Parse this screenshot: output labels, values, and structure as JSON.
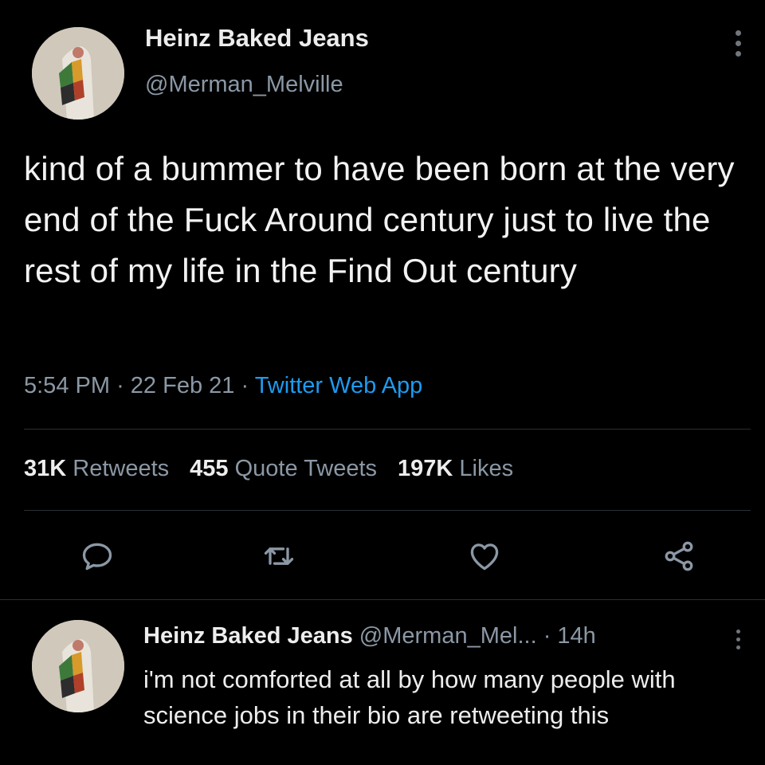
{
  "tweet": {
    "author_name": "Heinz Baked Jeans",
    "author_handle": "@Merman_Melville",
    "text": "kind of a bummer to have been born at the very end of the Fuck Around century just to live the rest of my life in the Find Out century",
    "time": "5:54 PM",
    "date": "22 Feb 21",
    "separator": "·",
    "source": "Twitter Web App"
  },
  "stats": {
    "retweets_count": "31K",
    "retweets_label": "Retweets",
    "quotes_count": "455",
    "quotes_label": "Quote Tweets",
    "likes_count": "197K",
    "likes_label": "Likes"
  },
  "actions": {
    "reply_icon": "reply-icon",
    "retweet_icon": "retweet-icon",
    "like_icon": "heart-icon",
    "share_icon": "share-icon"
  },
  "reply": {
    "author_name": "Heinz Baked Jeans",
    "author_handle": "@Merman_Mel...",
    "separator": "·",
    "age": "14h",
    "text": "i'm not comforted at all by how many people with science jobs in their bio are retweeting this"
  },
  "colors": {
    "background": "#000000",
    "text": "#e7e9ea",
    "secondary": "#8b98a5",
    "accent": "#1d9bf0"
  }
}
